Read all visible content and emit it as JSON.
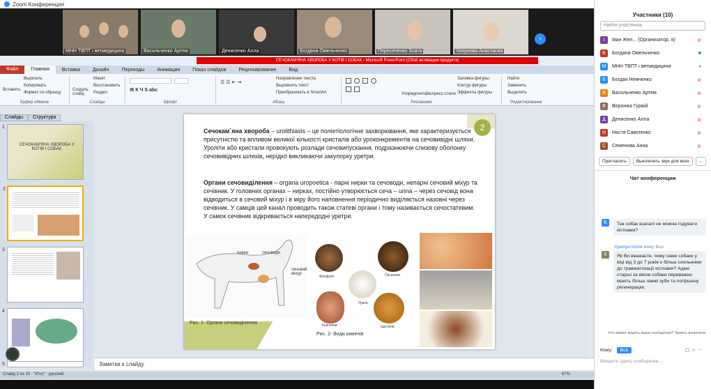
{
  "zoom": {
    "title": "Zoom Конференция"
  },
  "participants_strip": [
    {
      "name": "МНН ТВПТ і ветмедицина"
    },
    {
      "name": "Васильченко Артем"
    },
    {
      "name": "Денисенко Алла"
    },
    {
      "name": "Богдана Омельченко"
    },
    {
      "name": "Пересеченко Злата"
    },
    {
      "name": "Чопунова Анастасия"
    }
  ],
  "ppt": {
    "window_title": "СЕЧОКАМ'ЯНА ХВОРОБА У КОТІВ І СОБАК - Microsoft PowerPoint (Сбой активации продукта)",
    "tabs": [
      "Файл",
      "Главная",
      "Вставка",
      "Дизайн",
      "Переходы",
      "Анимация",
      "Показ слайдов",
      "Рецензирование",
      "Вид"
    ],
    "groups": [
      "Буфер обмена",
      "Слайды",
      "Шрифт",
      "Абзац",
      "Рисование",
      "Редактирование"
    ],
    "buttons": {
      "paste": "Вставить",
      "cut": "Вырезать",
      "copy": "Копировать",
      "format": "Формат по образцу",
      "new_slide": "Создать слайд",
      "layout": "Макет",
      "reset": "Восстановить",
      "section": "Раздел",
      "find": "Найти",
      "replace": "Заменить",
      "select": "Выделить",
      "arrange": "Упорядочить",
      "quick_styles": "Экспресс-стили",
      "fill": "Заливка фигуры",
      "outline": "Контур фигуры",
      "effects": "Эффекты фигуры",
      "text_dir": "Направление текста",
      "align_text": "Выровнять текст",
      "smartart": "Преобразовать в SmartArt"
    },
    "pane_tabs": [
      "Слайды",
      "Структура"
    ],
    "slide_thumbs": [
      {
        "num": "1",
        "title": "СЕЧОКАМ'ЯНА ХВОРОБА У КОТІВ І СОБАК"
      },
      {
        "num": "2"
      },
      {
        "num": "3"
      },
      {
        "num": "4"
      },
      {
        "num": "5"
      }
    ],
    "slide": {
      "number": "2",
      "p1_bold": "Сечокам`яна хвороба",
      "p1": " – urolithiasis – це поліетіологічне захворювання, яке характеризується присутністю та впливом великої кількості кристалів або уроконкрементів на сечовивідні шляхи. Уроліти або кристали провокують розлади сечовипускання, подразнюючи слизову оболонку сечовивідних шляхів, нерідко викликаючи закупорку уретри.",
      "p2_bold": "Органи сечовиділення",
      "p2": " – organa uropoetica - парні нирки та сечоводи, непарні сечовий міхур та сечівник. У головних органах – нирках, постійно утворюється сеча – urina – через сечовід вона відводиться в сечовий міхур і в міру його наповнення періодично виділяється назовні через сечівник. У самців цей канал проводить також статеві органи і тому називається сечостатевим. У самок сечівник відкривається напередодні уретри.",
      "labels": {
        "kidneys": "нирки",
        "ureters": "сечоводи",
        "bladder": "сечовий міхур",
        "phosphate": "Фосфати",
        "oxalate": "Оксалати",
        "urate": "Урати",
        "struvite": "Ксантини",
        "cystine": "Цистини"
      },
      "cap1": "Рис. 1- Органи сечовиділення",
      "cap2": "Рис. 2- Види каменів"
    },
    "notes": "Заметки к слайду",
    "status": {
      "slide": "Слайд 2 из 10",
      "theme": "\"Итог\"",
      "lang": "русский",
      "zoom": "67%"
    }
  },
  "panel": {
    "title": "Участники (10)",
    "search_placeholder": "Найти участника",
    "people": [
      {
        "name": "Іван Жел... (Организатор, я)",
        "initial": "І",
        "color": "#7b3fa0"
      },
      {
        "name": "Богдана Омельченко",
        "initial": "Б",
        "color": "#c0392b"
      },
      {
        "name": "МНН ТВПТ і ветмедицини",
        "initial": "М",
        "color": "#2d8cff"
      },
      {
        "name": "Богдан Немченко",
        "initial": "Б",
        "color": "#2d8cff"
      },
      {
        "name": "Васильченко Артем",
        "initial": "В",
        "color": "#e67e22"
      },
      {
        "name": "Вероніка Гуржій",
        "initial": "В",
        "color": "#8a6d5b"
      },
      {
        "name": "Денисенко Алла",
        "initial": "Д",
        "color": "#6c3fa0"
      },
      {
        "name": "Настя Савотенко",
        "initial": "Н",
        "color": "#c0392b"
      },
      {
        "name": "Семенова Анна",
        "initial": "С",
        "color": "#a0522d"
      }
    ],
    "invite": "Пригласить",
    "mute_all": "Выключить звук для всех",
    "more": "...",
    "chat_title": "Чат конференции",
    "msg1": "Так собак взагалі не можна годувати кістками?",
    "sender2": "Хрипун Юлія",
    "to2": "кому Все",
    "msg2": "Як Ви вважаєте, чому саме собаки у віці від 3 до 7 років є більш схильними до травматизації кістками? Адже старші за віком собаки переважно мають більш ламкі зуби та погіршену регенерацію.",
    "notice": "Кто может видеть ваши сообщения? Запись включена",
    "to_label": "Кому:",
    "to_value": "Все",
    "input_placeholder": "Введите здесь сообщение..."
  }
}
